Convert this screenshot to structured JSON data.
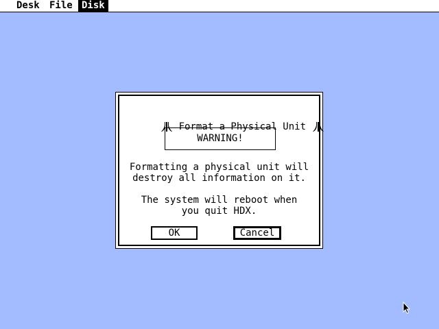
{
  "menubar": {
    "items": [
      {
        "label": "Desk",
        "active": false
      },
      {
        "label": "File",
        "active": false
      },
      {
        "label": "Disk",
        "active": true
      }
    ]
  },
  "dialog": {
    "title": "Format a Physical Unit",
    "title_icon": "atari-fuji-logo",
    "warning": "WARNING!",
    "message_lines_1": [
      "Formatting a physical unit will",
      "destroy all information on it."
    ],
    "message_lines_2": [
      "The system will reboot when",
      "you quit HDX."
    ],
    "ok_label": "OK",
    "cancel_label": "Cancel",
    "default_button": "cancel"
  },
  "colors": {
    "desktop": "#a2bcff",
    "dialog": "#ffffff",
    "ink": "#000000"
  },
  "cursor": {
    "icon": "arrow-pointer-icon"
  }
}
